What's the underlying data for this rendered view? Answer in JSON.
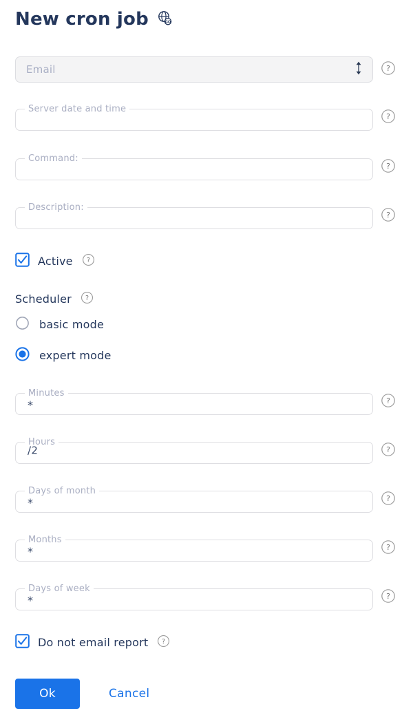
{
  "header": {
    "title": "New cron job",
    "globe_icon": "globe-go-icon"
  },
  "colors": {
    "accent": "#1a73e8",
    "title_text": "#24375c",
    "label_muted": "#a9aec2",
    "field_border": "#dedee2",
    "filled_field_bg": "#f4f4f5"
  },
  "fields": {
    "email": {
      "placeholder": "Email",
      "value": "",
      "type": "select",
      "help": "?",
      "trailing_icon": "up-down-arrow-icon"
    },
    "server_datetime": {
      "label": "Server date and time",
      "value": "",
      "help": "?"
    },
    "command": {
      "label": "Command:",
      "value": "",
      "help": "?"
    },
    "description": {
      "label": "Description:",
      "value": "",
      "help": "?"
    }
  },
  "active": {
    "label": "Active",
    "checked": true,
    "help": "?"
  },
  "scheduler": {
    "label": "Scheduler",
    "help": "?",
    "selected_mode": "expert mode",
    "options": [
      {
        "label": "basic mode",
        "selected": false
      },
      {
        "label": "expert mode",
        "selected": true
      }
    ]
  },
  "cron": {
    "minutes": {
      "label": "Minutes",
      "value": "*",
      "help": "?"
    },
    "hours": {
      "label": "Hours",
      "value": "/2",
      "help": "?"
    },
    "days_of_month": {
      "label": "Days of month",
      "value": "*",
      "help": "?"
    },
    "months": {
      "label": "Months",
      "value": "*",
      "help": "?"
    },
    "days_of_week": {
      "label": "Days of week",
      "value": "*",
      "help": "?"
    }
  },
  "do_not_email": {
    "label": "Do not email report",
    "checked": true,
    "help": "?"
  },
  "actions": {
    "ok_label": "Ok",
    "cancel_label": "Cancel"
  }
}
